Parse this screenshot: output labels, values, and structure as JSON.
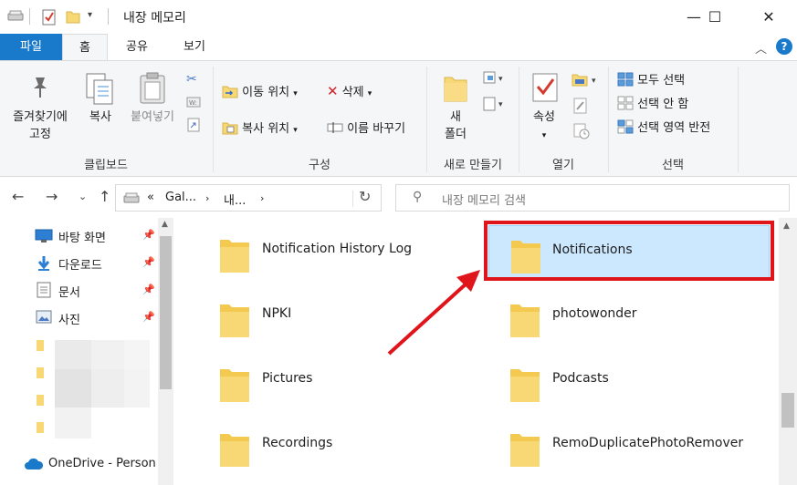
{
  "window": {
    "title": "내장 메모리",
    "controls": {
      "minimize": "—",
      "maximize": "☐",
      "close": "✕"
    }
  },
  "tabs": [
    {
      "label": "파일"
    },
    {
      "label": "홈"
    },
    {
      "label": "공유"
    },
    {
      "label": "보기"
    }
  ],
  "ribbon": {
    "clipboard": {
      "pin_label_1": "즐겨찾기에",
      "pin_label_2": "고정",
      "copy_label": "복사",
      "paste_label": "붙여넣기",
      "group_label": "클립보드"
    },
    "organize": {
      "move_to": "이동 위치",
      "copy_to": "복사 위치",
      "delete": "삭제",
      "rename": "이름 바꾸기",
      "group_label": "구성"
    },
    "new": {
      "new_folder_1": "새",
      "new_folder_2": "폴더",
      "group_label": "새로 만들기"
    },
    "open": {
      "properties": "속성",
      "group_label": "열기"
    },
    "select": {
      "select_all": "모두 선택",
      "select_none": "선택 안 함",
      "invert": "선택 영역 반전",
      "group_label": "선택"
    }
  },
  "address": {
    "crumb_prefix": "«",
    "crumb_1": "Gal...",
    "crumb_2": "내...",
    "search_placeholder": "내장 메모리 검색"
  },
  "nav": {
    "quick_access": [
      {
        "label": "바탕 화면",
        "icon": "desktop-icon"
      },
      {
        "label": "다운로드",
        "icon": "download-icon"
      },
      {
        "label": "문서",
        "icon": "document-icon"
      },
      {
        "label": "사진",
        "icon": "picture-icon"
      }
    ],
    "onedrive": "OneDrive - Person"
  },
  "folders": [
    {
      "name": "Notification History Log",
      "selected": false
    },
    {
      "name": "Notifications",
      "selected": true
    },
    {
      "name": "NPKI",
      "selected": false
    },
    {
      "name": "photowonder",
      "selected": false
    },
    {
      "name": "Pictures",
      "selected": false
    },
    {
      "name": "Podcasts",
      "selected": false
    },
    {
      "name": "Recordings",
      "selected": false
    },
    {
      "name": "RemoDuplicatePhotoRemover",
      "selected": false
    }
  ],
  "colors": {
    "accent": "#1979ca",
    "selection": "#cce8ff",
    "highlight": "#e0151b",
    "folder": "#f8d775"
  }
}
